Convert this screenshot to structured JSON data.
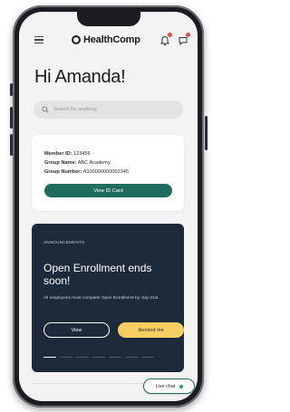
{
  "header": {
    "brand": "HealthComp",
    "menu_icon": "hamburger-menu-icon",
    "alerts_icon": "bell-icon",
    "messages_icon": "message-icon",
    "accent_color": "#1f6b5e"
  },
  "greeting": "Hi Amanda!",
  "search": {
    "placeholder": "Search for anything"
  },
  "member_card": {
    "member_id_label": "Member ID:",
    "member_id_value": "123456",
    "group_name_label": "Group Name:",
    "group_name_value": "ABC Academy",
    "group_number_label": "Group Number:",
    "group_number_value": "A100000000092345",
    "button_label": "View ID Card"
  },
  "announcement": {
    "label": "ANNOUNCEMENTS",
    "title": "Open Enrollment ends soon!",
    "body": "All employees must complete Open Enrollment by July 31st.",
    "view_label": "View",
    "remind_label": "Remind me",
    "page_count": 7,
    "active_page": 0,
    "background_color": "#1d2a3b",
    "remind_color": "#f5cf62"
  },
  "live_chat": {
    "label": "Live chat"
  }
}
